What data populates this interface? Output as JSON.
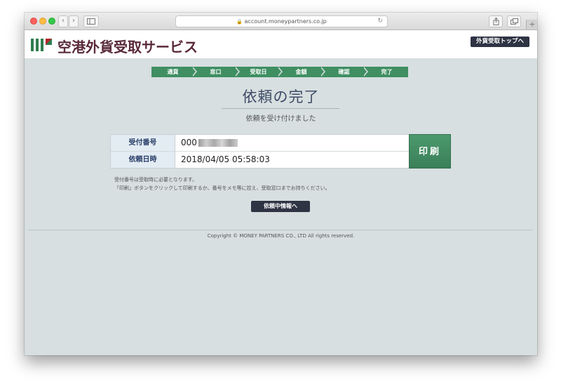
{
  "browser": {
    "url": "account.moneypartners.co.jp",
    "back_icon": "chevron-left-icon",
    "forward_icon": "chevron-right-icon",
    "reload_icon": "reload-icon",
    "new_tab_label": "+"
  },
  "header": {
    "logo_text": "空港外貨受取サービス",
    "top_button": "外貨受取トップへ",
    "brand_green": "#2e7d4f",
    "brand_red": "#b3262a"
  },
  "steps": [
    "通貨",
    "窓口",
    "受取日",
    "金額",
    "確認",
    "完了"
  ],
  "main": {
    "title": "依頼の完了",
    "subtitle": "依頼を受け付けました",
    "rows": [
      {
        "label": "受付番号",
        "value": "000"
      },
      {
        "label": "依頼日時",
        "value": "2018/04/05 05:58:03"
      }
    ],
    "print_button": "印刷",
    "note1": "受付番号は受取時に必要となります。",
    "note2": "「印刷」ボタンをクリックして印刷するか、番号をメモ等に控え、受取窓口までお持ちください。",
    "status_button": "依頼中情報へ"
  },
  "footer": {
    "copyright": "Copyright © MONEY PARTNERS CO., LTD All rights reserved."
  }
}
